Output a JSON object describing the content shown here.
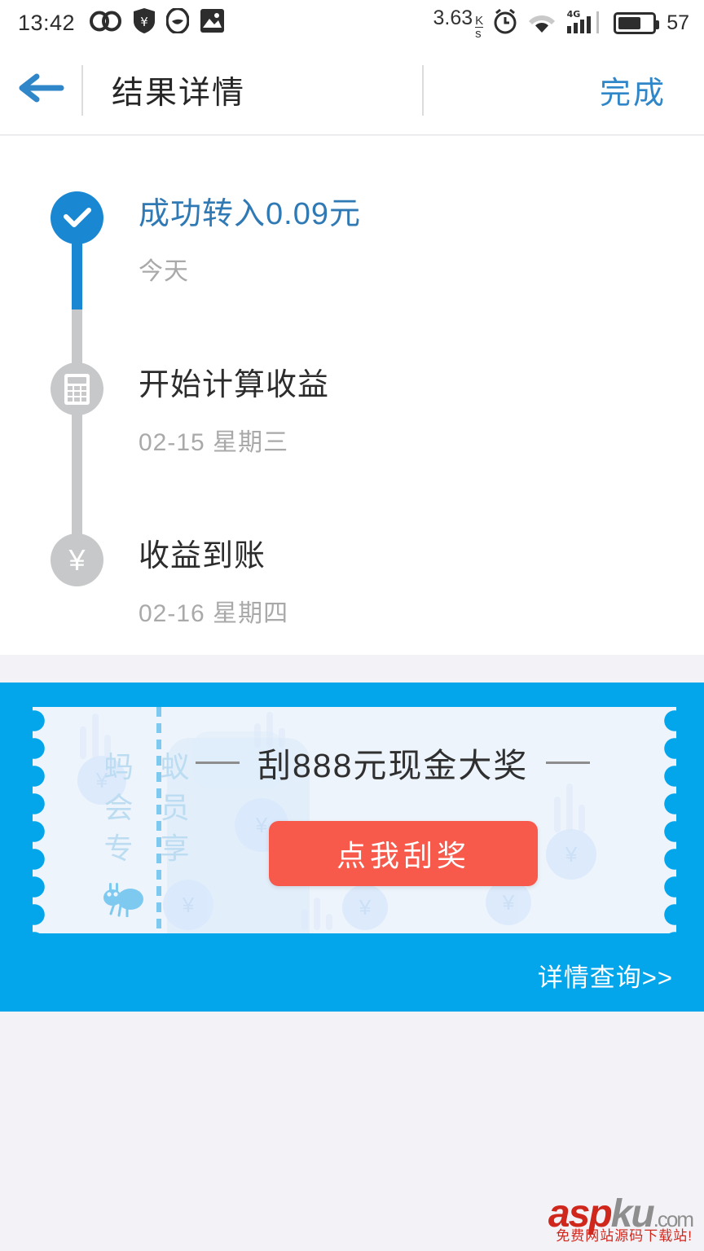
{
  "status_bar": {
    "time": "13:42",
    "left_icons": [
      "infinity-icon",
      "shield-yen-icon",
      "circle-leaf-icon",
      "gallery-icon"
    ],
    "network_speed": "3.63",
    "speed_unit_top": "K",
    "speed_unit_bottom": "s",
    "right_icons": [
      "alarm-clock-icon",
      "wifi-icon",
      "signal-4g-icon"
    ],
    "network_type": "4G",
    "battery_level": "57"
  },
  "header": {
    "back_icon": "arrow-left-icon",
    "title": "结果详情",
    "action_label": "完成",
    "accent_color": "#2f86c9"
  },
  "timeline": {
    "steps": [
      {
        "icon": "check-circle-icon",
        "title": "成功转入0.09元",
        "subtitle": "今天",
        "state": "done",
        "color": "#1a87d2"
      },
      {
        "icon": "calculator-icon",
        "title": "开始计算收益",
        "subtitle": "02-15 星期三",
        "state": "pending",
        "color": "#c6c8ca"
      },
      {
        "icon": "yen-icon",
        "title": "收益到账",
        "subtitle": "02-16 星期四",
        "state": "pending",
        "color": "#c6c8ca"
      }
    ]
  },
  "banner": {
    "background_color": "#03a6eb",
    "ticket_color": "#eef4fb",
    "stub_chars": [
      "蚂",
      "蚁",
      "会",
      "员",
      "专",
      "享"
    ],
    "stub_icon": "ant-icon",
    "headline": "刮888元现金大奖",
    "cta_label": "点我刮奖",
    "cta_color": "#f7594b",
    "more_label": "详情查询>>"
  },
  "watermark": {
    "brand_a": "asp",
    "brand_b": "ku",
    "brand_c": ".com",
    "tagline": "免费网站源码下载站!"
  }
}
